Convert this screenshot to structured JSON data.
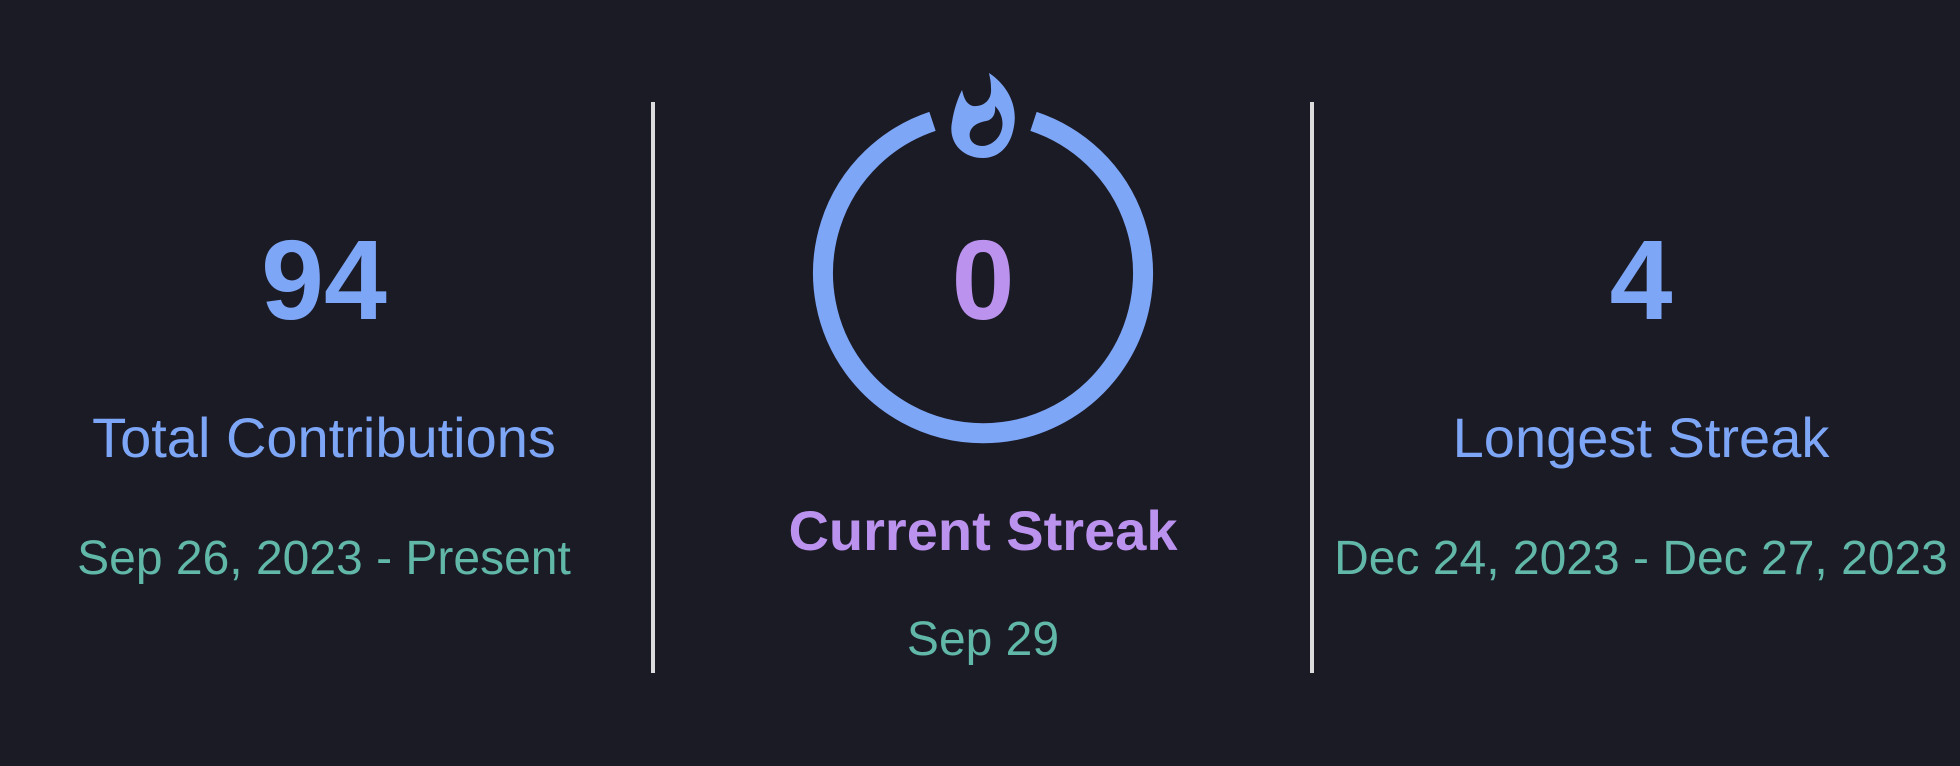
{
  "colors": {
    "background": "#1b1b26",
    "accent_blue": "#7ea6f7",
    "accent_purple": "#bb93ee",
    "date_teal": "#61b8a8",
    "divider": "#dcdcdc"
  },
  "total": {
    "value": "94",
    "label": "Total Contributions",
    "range": "Sep 26, 2023 - Present"
  },
  "current": {
    "value": "0",
    "label": "Current Streak",
    "range": "Sep 29",
    "icon": "fire-icon"
  },
  "longest": {
    "value": "4",
    "label": "Longest Streak",
    "range": "Dec 24, 2023 - Dec 27, 2023"
  }
}
